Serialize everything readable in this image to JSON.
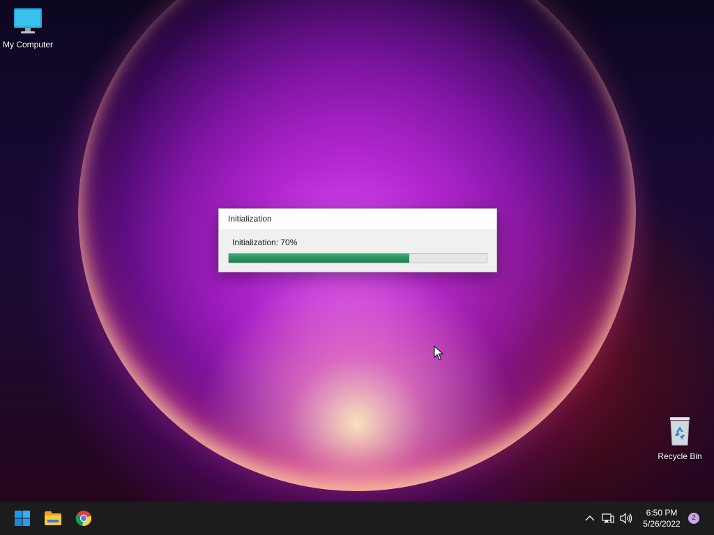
{
  "desktop": {
    "icons": [
      {
        "label": "My Computer",
        "icon": "monitor-icon"
      },
      {
        "label": "Recycle Bin",
        "icon": "recycle-bin-icon"
      }
    ]
  },
  "dialog": {
    "title": "Initialization",
    "status": "Initialization: 70%",
    "progress": 0.7
  },
  "taskbar": {
    "pinned": [
      {
        "name": "start",
        "icon": "windows-logo-icon"
      },
      {
        "name": "file-explorer",
        "icon": "folder-icon"
      },
      {
        "name": "chrome",
        "icon": "chrome-icon"
      }
    ],
    "tray": {
      "icons": [
        "chevron-up-icon",
        "network-icon",
        "volume-icon"
      ],
      "time": "6:50 PM",
      "date": "5/26/2022",
      "notifications": "2"
    }
  },
  "colors": {
    "accent": "#2a9463",
    "taskbar": "#1c1c1c"
  }
}
